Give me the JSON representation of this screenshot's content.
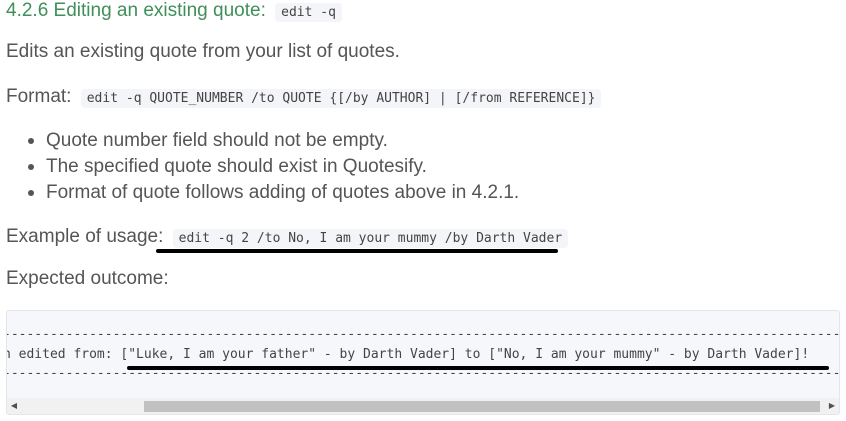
{
  "section": {
    "heading_text": "4.2.6 Editing an existing quote:",
    "heading_code": "edit -q"
  },
  "description": "Edits an existing quote from your list of quotes.",
  "format": {
    "label": "Format:",
    "code": "edit -q QUOTE_NUMBER /to QUOTE {[/by AUTHOR] | [/from REFERENCE]}"
  },
  "notes": [
    "Quote number field should not be empty.",
    "The specified quote should exist in Quotesify.",
    "Format of quote follows adding of quotes above in 4.2.1."
  ],
  "example": {
    "label": "Example of usage:",
    "code": "edit -q 2 /to No, I am your mummy /by Darth Vader"
  },
  "expected": {
    "label": "Expected outcome:",
    "output": "-----------------------------------------------------------------------------------------------------------------------------------------\nn edited from: [\"Luke, I am your father\" - by Darth Vader] to [\"No, I am your mummy\" - by Darth Vader]!\n-----------------------------------------------------------------------------------------------------------------------------------------"
  },
  "scrollbar": {
    "left_arrow": "◀",
    "right_arrow": "▶",
    "thumb_position": 0.99
  },
  "colors": {
    "heading": "#3f8f5a",
    "text": "#555555",
    "code_background": "#f3f5f8"
  }
}
